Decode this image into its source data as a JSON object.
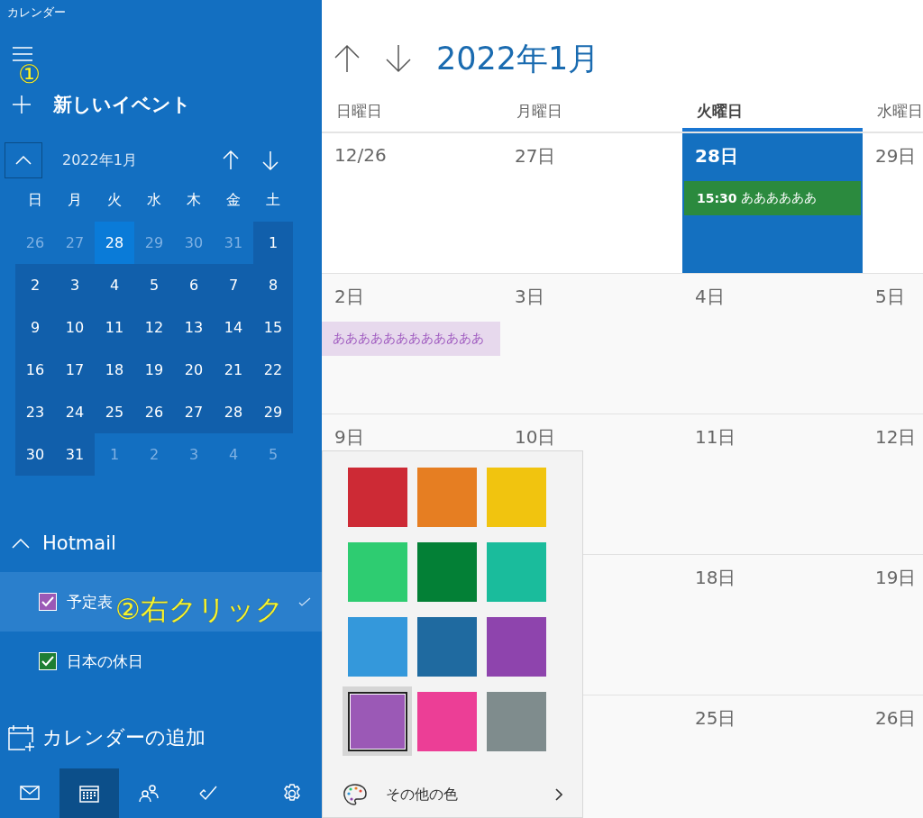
{
  "window": {
    "title": "カレンダー"
  },
  "sidebar": {
    "new_event": "新しいイベント",
    "mini_calendar": {
      "month": "2022年1月",
      "weekdays": [
        "日",
        "月",
        "火",
        "水",
        "木",
        "金",
        "土"
      ],
      "days": [
        {
          "label": "26",
          "in_month": false,
          "selected": false
        },
        {
          "label": "27",
          "in_month": false,
          "selected": false
        },
        {
          "label": "28",
          "in_month": false,
          "selected": true
        },
        {
          "label": "29",
          "in_month": false,
          "selected": false
        },
        {
          "label": "30",
          "in_month": false,
          "selected": false
        },
        {
          "label": "31",
          "in_month": false,
          "selected": false
        },
        {
          "label": "1",
          "in_month": true,
          "selected": false
        },
        {
          "label": "2",
          "in_month": true,
          "selected": false
        },
        {
          "label": "3",
          "in_month": true,
          "selected": false
        },
        {
          "label": "4",
          "in_month": true,
          "selected": false
        },
        {
          "label": "5",
          "in_month": true,
          "selected": false
        },
        {
          "label": "6",
          "in_month": true,
          "selected": false
        },
        {
          "label": "7",
          "in_month": true,
          "selected": false
        },
        {
          "label": "8",
          "in_month": true,
          "selected": false
        },
        {
          "label": "9",
          "in_month": true,
          "selected": false
        },
        {
          "label": "10",
          "in_month": true,
          "selected": false
        },
        {
          "label": "11",
          "in_month": true,
          "selected": false
        },
        {
          "label": "12",
          "in_month": true,
          "selected": false
        },
        {
          "label": "13",
          "in_month": true,
          "selected": false
        },
        {
          "label": "14",
          "in_month": true,
          "selected": false
        },
        {
          "label": "15",
          "in_month": true,
          "selected": false
        },
        {
          "label": "16",
          "in_month": true,
          "selected": false
        },
        {
          "label": "17",
          "in_month": true,
          "selected": false
        },
        {
          "label": "18",
          "in_month": true,
          "selected": false
        },
        {
          "label": "19",
          "in_month": true,
          "selected": false
        },
        {
          "label": "20",
          "in_month": true,
          "selected": false
        },
        {
          "label": "21",
          "in_month": true,
          "selected": false
        },
        {
          "label": "22",
          "in_month": true,
          "selected": false
        },
        {
          "label": "23",
          "in_month": true,
          "selected": false
        },
        {
          "label": "24",
          "in_month": true,
          "selected": false
        },
        {
          "label": "25",
          "in_month": true,
          "selected": false
        },
        {
          "label": "26",
          "in_month": true,
          "selected": false
        },
        {
          "label": "27",
          "in_month": true,
          "selected": false
        },
        {
          "label": "28",
          "in_month": true,
          "selected": false
        },
        {
          "label": "29",
          "in_month": true,
          "selected": false
        },
        {
          "label": "30",
          "in_month": true,
          "selected": false
        },
        {
          "label": "31",
          "in_month": true,
          "selected": false
        },
        {
          "label": "1",
          "in_month": false,
          "selected": false
        },
        {
          "label": "2",
          "in_month": false,
          "selected": false
        },
        {
          "label": "3",
          "in_month": false,
          "selected": false
        },
        {
          "label": "4",
          "in_month": false,
          "selected": false
        },
        {
          "label": "5",
          "in_month": false,
          "selected": false
        }
      ]
    },
    "accounts": [
      {
        "name": "Hotmail",
        "expanded": true,
        "calendars": [
          {
            "name": "予定表",
            "checked": true,
            "color": "#9b59b6",
            "selected": true
          },
          {
            "name": "日本の休日",
            "checked": true,
            "color": "#1e7e34",
            "selected": false
          }
        ]
      }
    ],
    "add_calendar": "カレンダーの追加",
    "nav": [
      {
        "kind": "mail",
        "selected": false
      },
      {
        "kind": "calendar",
        "selected": true
      },
      {
        "kind": "people",
        "selected": false
      },
      {
        "kind": "todo",
        "selected": false
      },
      {
        "kind": "settings",
        "selected": false
      }
    ]
  },
  "annotations": [
    {
      "kind": "menu",
      "text": "①"
    },
    {
      "kind": "row",
      "text": "②右クリック"
    }
  ],
  "main": {
    "month_title": "2022年1月",
    "weekdays": [
      {
        "label": "日曜日",
        "selected": false
      },
      {
        "label": "月曜日",
        "selected": false
      },
      {
        "label": "火曜日",
        "selected": true
      },
      {
        "label": "水曜日",
        "selected": false
      }
    ],
    "weeks": [
      {
        "days": [
          {
            "label": "12/26",
            "today": false
          },
          {
            "label": "27日",
            "today": false
          },
          {
            "label": "28日",
            "today": true,
            "events": [
              {
                "kind": "timed",
                "time": "15:30",
                "title": "ああああああ",
                "color": "#2b8a3e"
              }
            ]
          },
          {
            "label": "29日",
            "today": false
          }
        ]
      },
      {
        "days": [
          {
            "label": "2日",
            "today": false,
            "events": [
              {
                "kind": "allday",
                "title": "ああああああああああああ",
                "color": "#a05cc0"
              }
            ]
          },
          {
            "label": "3日",
            "today": false
          },
          {
            "label": "4日",
            "today": false
          },
          {
            "label": "5日",
            "today": false
          }
        ]
      },
      {
        "days": [
          {
            "label": "9日",
            "today": false
          },
          {
            "label": "10日",
            "today": false
          },
          {
            "label": "11日",
            "today": false
          },
          {
            "label": "12日",
            "today": false
          }
        ]
      },
      {
        "days": [
          {
            "label": "18日",
            "today": false
          },
          {
            "label": "19日",
            "today": false
          }
        ]
      },
      {
        "days": [
          {
            "label": "25日",
            "today": false
          },
          {
            "label": "26日",
            "today": false
          }
        ]
      }
    ]
  },
  "color_menu": {
    "colors": [
      {
        "color": "#cd2a35",
        "selected": false
      },
      {
        "color": "#e67e22",
        "selected": false
      },
      {
        "color": "#f1c40f",
        "selected": false
      },
      {
        "color": "#2ecc71",
        "selected": false
      },
      {
        "color": "#038036",
        "selected": false
      },
      {
        "color": "#1abc9c",
        "selected": false
      },
      {
        "color": "#3498db",
        "selected": false
      },
      {
        "color": "#1f6aa0",
        "selected": false
      },
      {
        "color": "#8e44ad",
        "selected": false
      },
      {
        "color": "#9b59b6",
        "selected": true
      },
      {
        "color": "#ec3e96",
        "selected": false
      },
      {
        "color": "#7f8c8d",
        "selected": false
      }
    ],
    "more_colors": "その他の色"
  }
}
